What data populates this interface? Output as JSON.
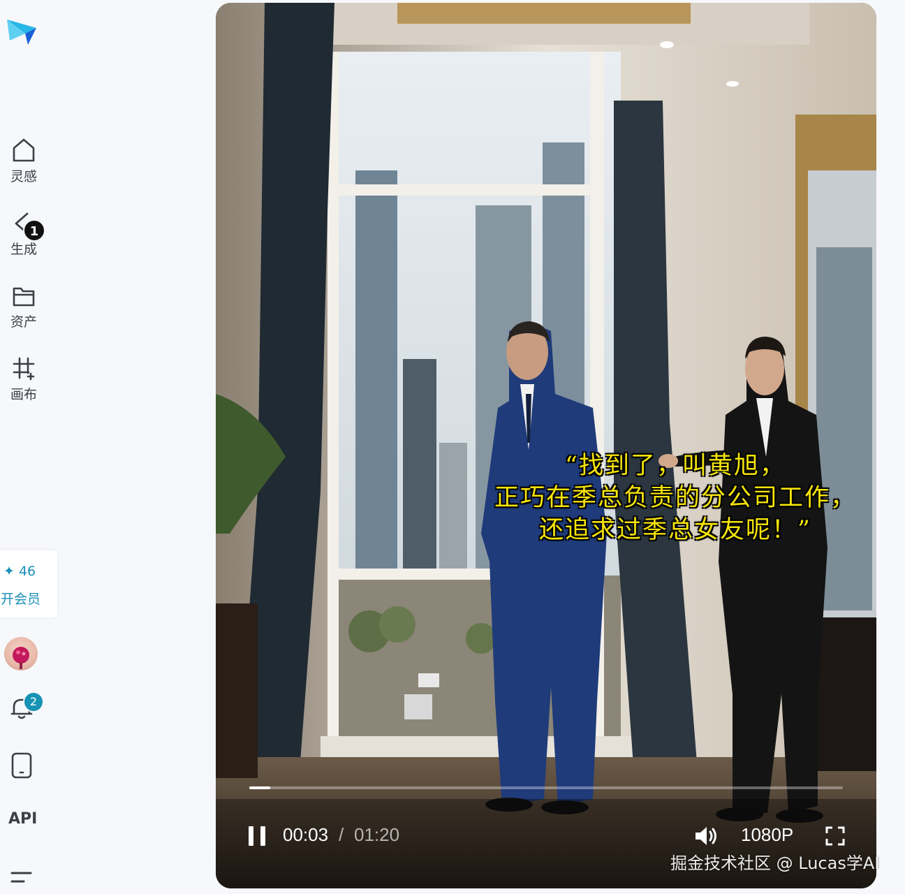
{
  "sidebar": {
    "items": [
      {
        "label": "灵感",
        "icon": "home-icon"
      },
      {
        "label": "生成",
        "icon": "generate-icon",
        "badge": "1"
      },
      {
        "label": "资产",
        "icon": "folder-icon"
      },
      {
        "label": "画布",
        "icon": "canvas-icon"
      }
    ],
    "credits": "✦ 46",
    "vip_label": "开会员",
    "notifications_badge": "2",
    "api_label": "API"
  },
  "player": {
    "subtitle_lines": [
      "“找到了，叫黄旭，",
      "正巧在季总负责的分公司工作，",
      "还追求过季总女友呢！”"
    ],
    "current_time": "00:03",
    "separator": "/",
    "total_time": "01:20",
    "progress": 0.035,
    "quality": "1080P"
  },
  "watermark": "掘金技术社区 @ Lucas学AI"
}
